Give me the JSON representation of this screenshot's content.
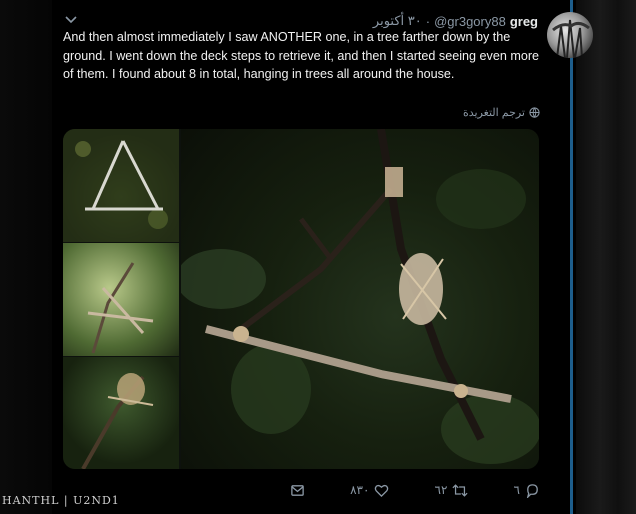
{
  "user": {
    "name": "greg",
    "handle": "@gr3gory88",
    "separator": "·",
    "time": "٣٠ أكتوبر"
  },
  "tweet": {
    "text": "And then almost immediately I saw ANOTHER one, in a tree farther down by the ground. I went down the deck steps to retrieve it, and then I started seeing even more of them. I found about 8 in total, hanging in trees all around the house.",
    "translate_label": "ترجم التغريدة"
  },
  "actions": {
    "reply_count": "٦",
    "retweet_count": "٦٢",
    "like_count": "٨٣٠"
  },
  "watermark": "HANTHL | U2ND1",
  "colors": {
    "thread_line": "#1d5e8c",
    "secondary_text": "#8b98a5"
  },
  "icons": [
    "chevron-down-icon",
    "globe-icon",
    "reply-icon",
    "retweet-icon",
    "like-icon",
    "share-icon"
  ]
}
